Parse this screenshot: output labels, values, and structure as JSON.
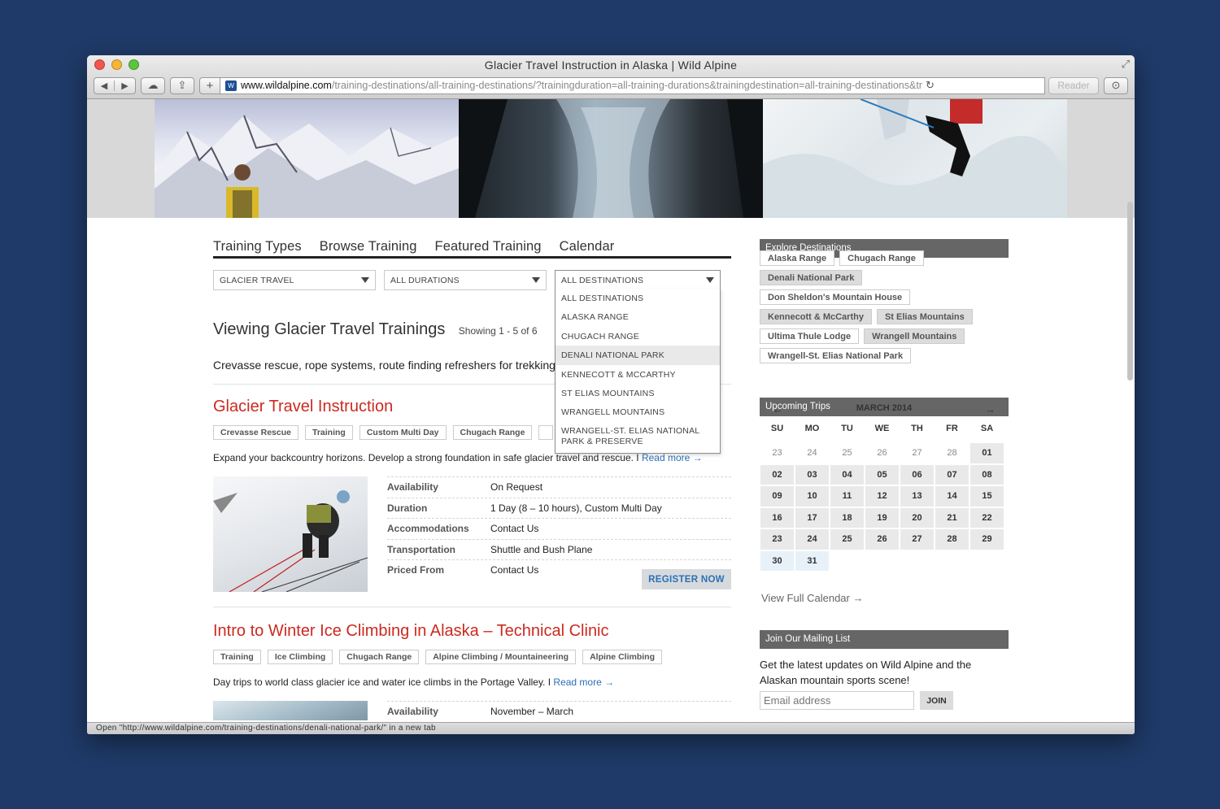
{
  "window": {
    "title": "Glacier Travel Instruction in Alaska | Wild Alpine",
    "url_host": "www.wildalpine.com",
    "url_path": "/training-destinations/all-training-destinations/?trainingduration=all-training-durations&trainingdestination=all-training-destinations&tr",
    "reader_label": "Reader",
    "status_text": "Open \"http://www.wildalpine.com/training-destinations/denali-national-park/\" in a new tab"
  },
  "colors": {
    "title_red": "#cc2a1f",
    "link_blue": "#2a6fb5",
    "sidebar_header": "#666666",
    "page_bg": "#1f3a68"
  },
  "tabs": [
    "Training Types",
    "Browse Training",
    "Featured Training",
    "Calendar"
  ],
  "filters": {
    "type": "GLACIER TRAVEL",
    "duration": "ALL DURATIONS",
    "destination": "ALL DESTINATIONS"
  },
  "dropdown": {
    "items": [
      "ALL DESTINATIONS",
      "ALASKA RANGE",
      "CHUGACH RANGE",
      "DENALI NATIONAL PARK",
      "KENNECOTT & MCCARTHY",
      "ST ELIAS MOUNTAINS",
      "WRANGELL MOUNTAINS",
      "WRANGELL-ST. ELIAS NATIONAL PARK & PRESERVE"
    ],
    "highlighted": "DENALI NATIONAL PARK"
  },
  "listing": {
    "heading": "Viewing Glacier Travel Trainings",
    "count": "Showing 1 - 5 of 6",
    "description": "Crevasse rescue, rope systems, route finding refreshers for trekking"
  },
  "trainings": [
    {
      "title": "Glacier Travel Instruction",
      "tags": [
        "Crevasse Rescue",
        "Training",
        "Custom Multi Day",
        "Chugach Range",
        ""
      ],
      "summary": "Expand your backcountry horizons. Develop a strong foundation in safe glacier travel and rescue. I ",
      "read_more": "Read more →",
      "details": [
        {
          "label": "Availability",
          "value": "On Request"
        },
        {
          "label": "Duration",
          "value": "1 Day (8 – 10 hours), Custom Multi Day"
        },
        {
          "label": "Accommodations",
          "value": "Contact Us"
        },
        {
          "label": "Transportation",
          "value": "Shuttle and Bush Plane"
        },
        {
          "label": "Priced From",
          "value": "Contact Us"
        }
      ],
      "register_label": "REGISTER NOW"
    },
    {
      "title": "Intro to Winter Ice Climbing in Alaska – Technical Clinic",
      "tags": [
        "Training",
        "Ice Climbing",
        "Chugach Range",
        "Alpine Climbing / Mountaineering",
        "Alpine Climbing"
      ],
      "summary": "Day trips to world class glacier ice and water ice climbs in the Portage Valley. I ",
      "read_more": "Read more →",
      "details": [
        {
          "label": "Availability",
          "value": "November – March"
        }
      ]
    }
  ],
  "sidebar": {
    "explore_title": "Explore Destinations",
    "destinations": [
      {
        "name": "Alaska Range",
        "dark": false
      },
      {
        "name": "Chugach Range",
        "dark": false
      },
      {
        "name": "Denali National Park",
        "dark": true
      },
      {
        "name": "Don Sheldon's Mountain House",
        "dark": false
      },
      {
        "name": "Kennecott & McCarthy",
        "dark": true
      },
      {
        "name": "St Elias Mountains",
        "dark": true
      },
      {
        "name": "Ultima Thule Lodge",
        "dark": false
      },
      {
        "name": "Wrangell Mountains",
        "dark": true
      },
      {
        "name": "Wrangell-St. Elias National Park",
        "dark": false
      }
    ],
    "trips_title": "Upcoming Trips",
    "calendar": {
      "month": "MARCH 2014",
      "prev": "←",
      "next": "→",
      "weekdays": [
        "SU",
        "MO",
        "TU",
        "WE",
        "TH",
        "FR",
        "SA"
      ],
      "prev_month_days": [
        "23",
        "24",
        "25",
        "26",
        "27",
        "28"
      ],
      "days": [
        "01",
        "02",
        "03",
        "04",
        "05",
        "06",
        "07",
        "08",
        "09",
        "10",
        "11",
        "12",
        "13",
        "14",
        "15",
        "16",
        "17",
        "18",
        "19",
        "20",
        "21",
        "22",
        "23",
        "24",
        "25",
        "26",
        "27",
        "28",
        "29",
        "30",
        "31"
      ],
      "highlighted_days": [
        "30",
        "31"
      ],
      "view_full": "View Full Calendar →"
    },
    "mailing_title": "Join Our Mailing List",
    "mailing_text": "Get the latest updates on Wild Alpine and the Alaskan mountain sports scene!",
    "email_placeholder": "Email address",
    "join_label": "JOIN"
  }
}
